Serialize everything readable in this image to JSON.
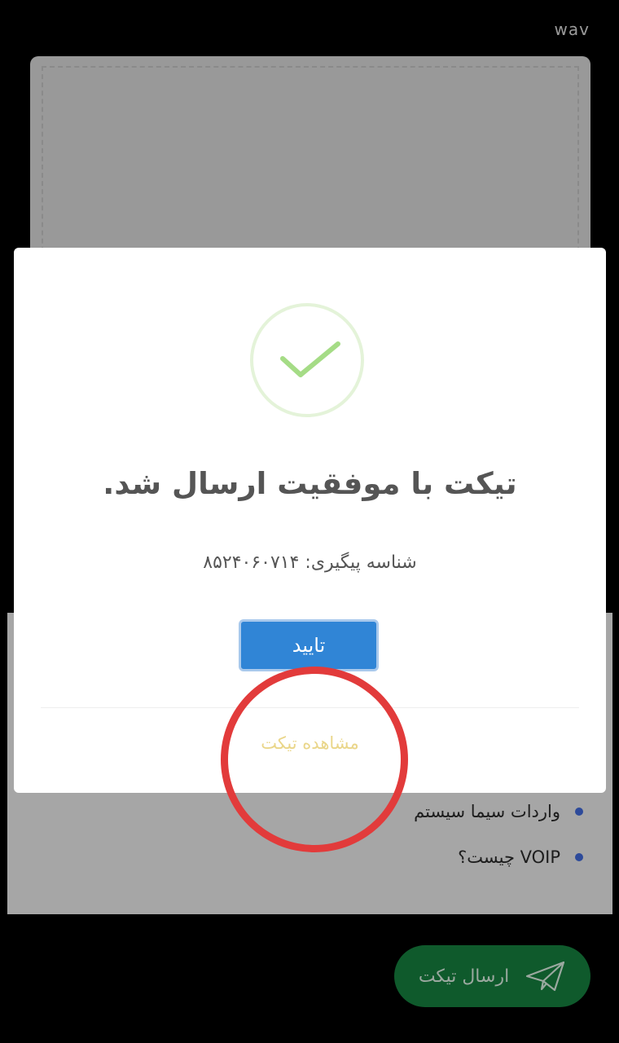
{
  "upload": {
    "file_ext_label": "wav"
  },
  "faq": {
    "items": [
      {
        "label": "واردات سیما سیستم"
      },
      {
        "label": "VOIP چیست؟"
      }
    ]
  },
  "send_ticket": {
    "label": "ارسال تیکت",
    "icon": "paper-plane-icon"
  },
  "modal": {
    "icon": "check-icon",
    "title": "تیکت با موفقیت ارسال شد.",
    "tracking_label": "شناسه پیگیری:",
    "tracking_id": "۸۵۲۴۰۶۰۷۱۴",
    "confirm_label": "تایید",
    "view_ticket_label": "مشاهده تیکت"
  },
  "colors": {
    "confirm": "#3085d6",
    "success": "#a5dc86",
    "send_button": "#0f5a2c",
    "highlight": "#e23b3b"
  }
}
